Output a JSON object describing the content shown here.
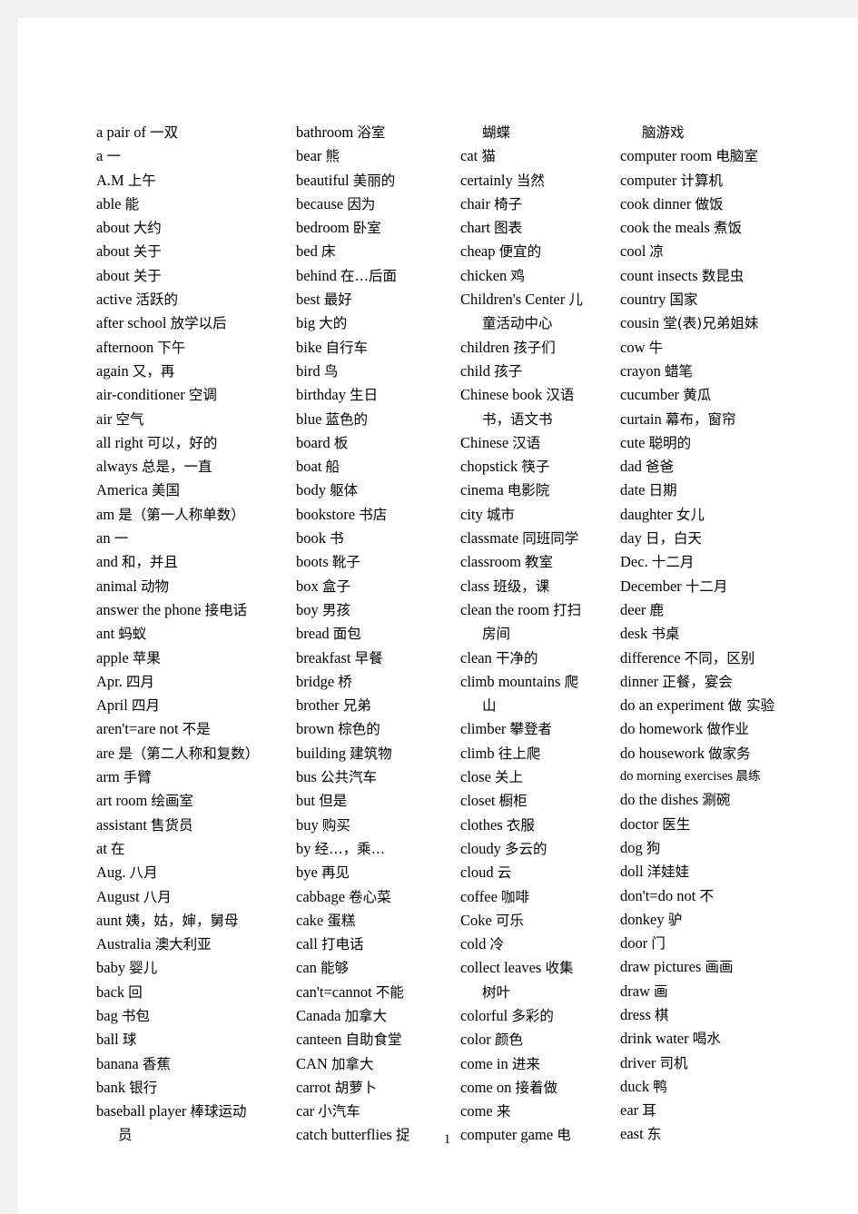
{
  "document": {
    "page_number": "1",
    "columns": [
      {
        "name": "column-1",
        "entries": [
          {
            "en": "a pair of",
            "cn": "一双"
          },
          {
            "en": "a",
            "cn": "一"
          },
          {
            "en": "A.M",
            "cn": "上午"
          },
          {
            "en": "able",
            "cn": "能"
          },
          {
            "en": "about",
            "cn": "大约"
          },
          {
            "en": "about",
            "cn": "关于"
          },
          {
            "en": "about",
            "cn": "关于"
          },
          {
            "en": "active",
            "cn": "活跃的"
          },
          {
            "en": "after school",
            "cn": "放学以后"
          },
          {
            "en": "afternoon",
            "cn": "下午"
          },
          {
            "en": "again",
            "cn": "又，再"
          },
          {
            "en": "air-conditioner",
            "cn": "空调"
          },
          {
            "en": "air",
            "cn": "空气"
          },
          {
            "en": "all right",
            "cn": "可以，好的"
          },
          {
            "en": "always",
            "cn": "总是，一直"
          },
          {
            "en": "America",
            "cn": "美国"
          },
          {
            "en": "am",
            "cn": "是（第一人称单数）"
          },
          {
            "en": "an",
            "cn": "一"
          },
          {
            "en": "and",
            "cn": "和，并且"
          },
          {
            "en": "animal",
            "cn": "动物"
          },
          {
            "en": "answer the phone",
            "cn": "接电话"
          },
          {
            "en": "ant",
            "cn": "蚂蚁"
          },
          {
            "en": "apple",
            "cn": "苹果"
          },
          {
            "en": "Apr.",
            "cn": "四月"
          },
          {
            "en": "April",
            "cn": "四月"
          },
          {
            "en": "aren't=are not",
            "cn": "不是"
          },
          {
            "en": "are",
            "cn": "是（第二人称和复数）"
          },
          {
            "en": "arm",
            "cn": "手臂"
          },
          {
            "en": "art room",
            "cn": "绘画室"
          },
          {
            "en": "assistant",
            "cn": "售货员"
          },
          {
            "en": "at",
            "cn": "在"
          },
          {
            "en": "Aug.",
            "cn": "八月"
          },
          {
            "en": "August",
            "cn": "八月"
          },
          {
            "en": "aunt",
            "cn": "姨，姑，婶，舅母"
          },
          {
            "en": "Australia",
            "cn": "澳大利亚"
          },
          {
            "en": "baby",
            "cn": "婴儿"
          },
          {
            "en": "back",
            "cn": "回"
          },
          {
            "en": "bag",
            "cn": "书包"
          },
          {
            "en": "ball",
            "cn": "球"
          },
          {
            "en": "banana",
            "cn": "香蕉"
          },
          {
            "en": "bank",
            "cn": "银行"
          },
          {
            "en": "baseball player",
            "cn": "棒球运动"
          },
          {
            "en": "",
            "cn": "员",
            "continuation": true
          }
        ]
      },
      {
        "name": "column-2",
        "entries": [
          {
            "en": "bathroom",
            "cn": "浴室"
          },
          {
            "en": "bear",
            "cn": "熊"
          },
          {
            "en": "beautiful",
            "cn": "美丽的"
          },
          {
            "en": "because",
            "cn": "因为"
          },
          {
            "en": "bedroom",
            "cn": "卧室"
          },
          {
            "en": "bed",
            "cn": "床"
          },
          {
            "en": "behind",
            "cn": "在…后面"
          },
          {
            "en": "best",
            "cn": "最好"
          },
          {
            "en": "big",
            "cn": "大的"
          },
          {
            "en": "bike",
            "cn": "自行车"
          },
          {
            "en": "bird",
            "cn": "鸟"
          },
          {
            "en": "birthday",
            "cn": "生日"
          },
          {
            "en": "blue",
            "cn": "蓝色的"
          },
          {
            "en": "board",
            "cn": "板"
          },
          {
            "en": "boat",
            "cn": "船"
          },
          {
            "en": "body",
            "cn": "躯体"
          },
          {
            "en": "bookstore",
            "cn": "书店"
          },
          {
            "en": "book",
            "cn": "书"
          },
          {
            "en": "boots",
            "cn": "靴子"
          },
          {
            "en": "box",
            "cn": "盒子"
          },
          {
            "en": "boy",
            "cn": "男孩"
          },
          {
            "en": "bread",
            "cn": "面包"
          },
          {
            "en": "breakfast",
            "cn": "早餐"
          },
          {
            "en": "bridge",
            "cn": "桥"
          },
          {
            "en": "brother",
            "cn": "兄弟"
          },
          {
            "en": "brown",
            "cn": "棕色的"
          },
          {
            "en": "building",
            "cn": "建筑物"
          },
          {
            "en": "bus",
            "cn": "公共汽车"
          },
          {
            "en": "but",
            "cn": "但是"
          },
          {
            "en": "buy",
            "cn": "购买"
          },
          {
            "en": "by",
            "cn": "经…，乘…"
          },
          {
            "en": "bye",
            "cn": "再见"
          },
          {
            "en": "cabbage",
            "cn": "卷心菜"
          },
          {
            "en": "cake",
            "cn": "蛋糕"
          },
          {
            "en": "call",
            "cn": "打电话"
          },
          {
            "en": "can",
            "cn": "能够"
          },
          {
            "en": "can't=cannot",
            "cn": "不能"
          },
          {
            "en": "Canada",
            "cn": "加拿大"
          },
          {
            "en": "canteen",
            "cn": "自助食堂"
          },
          {
            "en": "CAN",
            "cn": "加拿大"
          },
          {
            "en": "carrot",
            "cn": "胡萝卜"
          },
          {
            "en": "car",
            "cn": "小汽车"
          },
          {
            "en": "catch butterflies",
            "cn": "捉"
          }
        ]
      },
      {
        "name": "column-3",
        "entries": [
          {
            "en": "",
            "cn": "蝴蝶",
            "continuation": true
          },
          {
            "en": "cat",
            "cn": "猫"
          },
          {
            "en": "certainly",
            "cn": "当然"
          },
          {
            "en": "chair",
            "cn": "椅子"
          },
          {
            "en": "chart",
            "cn": "图表"
          },
          {
            "en": "cheap",
            "cn": "便宜的"
          },
          {
            "en": "chicken",
            "cn": "鸡"
          },
          {
            "en": "Children's Center",
            "cn": "儿"
          },
          {
            "en": "",
            "cn": "童活动中心",
            "continuation": true
          },
          {
            "en": "children",
            "cn": "孩子们"
          },
          {
            "en": "child",
            "cn": "孩子"
          },
          {
            "en": "Chinese book",
            "cn": "汉语"
          },
          {
            "en": "",
            "cn": "书，语文书",
            "continuation": true
          },
          {
            "en": "Chinese",
            "cn": "汉语"
          },
          {
            "en": "chopstick",
            "cn": "筷子"
          },
          {
            "en": "cinema",
            "cn": "电影院"
          },
          {
            "en": "city",
            "cn": "城市"
          },
          {
            "en": "classmate",
            "cn": "同班同学"
          },
          {
            "en": "classroom",
            "cn": "教室"
          },
          {
            "en": "class",
            "cn": "班级，课"
          },
          {
            "en": "clean the room",
            "cn": "打扫"
          },
          {
            "en": "",
            "cn": "房间",
            "continuation": true
          },
          {
            "en": "clean",
            "cn": "干净的"
          },
          {
            "en": "climb mountains",
            "cn": "爬"
          },
          {
            "en": "",
            "cn": "山",
            "continuation": true
          },
          {
            "en": "climber",
            "cn": "攀登者"
          },
          {
            "en": "climb",
            "cn": "往上爬"
          },
          {
            "en": "close",
            "cn": "关上"
          },
          {
            "en": "closet",
            "cn": "橱柜"
          },
          {
            "en": "clothes",
            "cn": "衣服"
          },
          {
            "en": "cloudy",
            "cn": "多云的"
          },
          {
            "en": "cloud",
            "cn": "云"
          },
          {
            "en": "coffee",
            "cn": "咖啡"
          },
          {
            "en": "Coke",
            "cn": "可乐"
          },
          {
            "en": "cold",
            "cn": "冷"
          },
          {
            "en": "collect leaves",
            "cn": "收集"
          },
          {
            "en": "",
            "cn": "树叶",
            "continuation": true
          },
          {
            "en": "colorful",
            "cn": "多彩的"
          },
          {
            "en": "color",
            "cn": "颜色"
          },
          {
            "en": "come in",
            "cn": "进来"
          },
          {
            "en": "come on",
            "cn": "接着做"
          },
          {
            "en": "come",
            "cn": "来"
          },
          {
            "en": "computer game",
            "cn": "电"
          }
        ]
      },
      {
        "name": "column-4",
        "entries": [
          {
            "en": "",
            "cn": "脑游戏",
            "continuation": true
          },
          {
            "en": "computer room",
            "cn": "电脑室"
          },
          {
            "en": "computer",
            "cn": "计算机"
          },
          {
            "en": "cook dinner",
            "cn": "做饭"
          },
          {
            "en": "cook the meals",
            "cn": "煮饭"
          },
          {
            "en": "cool",
            "cn": "凉"
          },
          {
            "en": "count insects",
            "cn": "数昆虫"
          },
          {
            "en": "country",
            "cn": "国家"
          },
          {
            "en": "cousin",
            "cn": "堂(表)兄弟姐妹"
          },
          {
            "en": "cow",
            "cn": "牛"
          },
          {
            "en": "crayon",
            "cn": "蜡笔"
          },
          {
            "en": "cucumber",
            "cn": "黄瓜"
          },
          {
            "en": "curtain",
            "cn": "幕布，窗帘"
          },
          {
            "en": "cute",
            "cn": "聪明的"
          },
          {
            "en": "dad",
            "cn": "爸爸"
          },
          {
            "en": "date",
            "cn": "日期"
          },
          {
            "en": "daughter",
            "cn": "女儿"
          },
          {
            "en": "day",
            "cn": "日，白天"
          },
          {
            "en": "Dec.",
            "cn": "十二月"
          },
          {
            "en": "December",
            "cn": "十二月"
          },
          {
            "en": "deer",
            "cn": "鹿"
          },
          {
            "en": "desk",
            "cn": "书桌"
          },
          {
            "en": "difference",
            "cn": "不同，区别"
          },
          {
            "en": "dinner",
            "cn": "正餐，宴会"
          },
          {
            "en": "do an experiment",
            "cn": "做 实验"
          },
          {
            "en": "do homework",
            "cn": "做作业"
          },
          {
            "en": "do housework",
            "cn": "做家务"
          },
          {
            "en": "do morning exercises",
            "cn": "晨练",
            "small": true
          },
          {
            "en": "do the dishes",
            "cn": "涮碗"
          },
          {
            "en": "doctor",
            "cn": "医生"
          },
          {
            "en": "dog",
            "cn": "狗"
          },
          {
            "en": "doll",
            "cn": "洋娃娃"
          },
          {
            "en": "don't=do not",
            "cn": "不"
          },
          {
            "en": "donkey",
            "cn": "驴"
          },
          {
            "en": "door",
            "cn": "门"
          },
          {
            "en": "draw pictures",
            "cn": "画画"
          },
          {
            "en": "draw",
            "cn": "画"
          },
          {
            "en": "dress",
            "cn": "棋"
          },
          {
            "en": "drink water",
            "cn": "喝水"
          },
          {
            "en": "driver",
            "cn": "司机"
          },
          {
            "en": "duck",
            "cn": "鸭"
          },
          {
            "en": "ear",
            "cn": "耳"
          },
          {
            "en": "east",
            "cn": "东"
          }
        ]
      }
    ]
  }
}
